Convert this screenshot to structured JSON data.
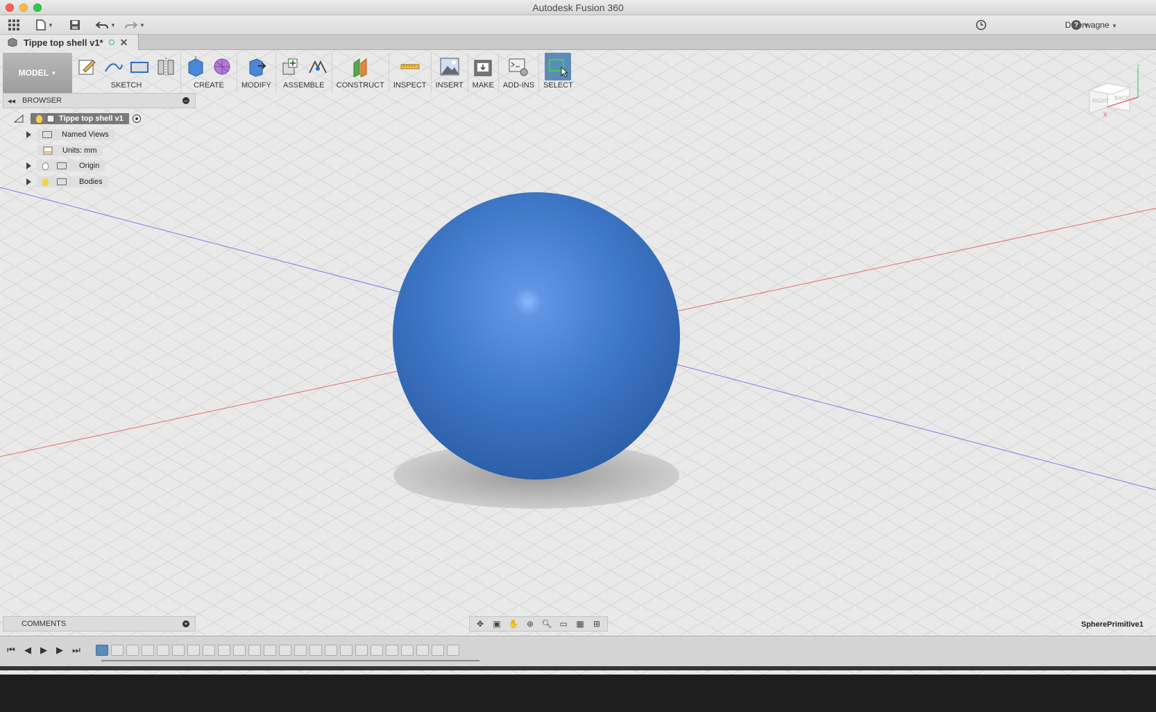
{
  "window": {
    "title": "Autodesk Fusion 360"
  },
  "qat": {
    "user": "D Terwagne",
    "help": "?"
  },
  "doc_tab": {
    "label": "Tippe top shell v1*"
  },
  "toolbar": {
    "workspace": "MODEL",
    "groups": [
      {
        "label": "SKETCH",
        "icons": [
          "create-sketch-icon",
          "spline-icon",
          "rectangle-icon",
          "mirror-icon"
        ]
      },
      {
        "label": "CREATE",
        "icons": [
          "extrude-box-icon",
          "form-icon"
        ]
      },
      {
        "label": "MODIFY",
        "icons": [
          "press-pull-icon"
        ]
      },
      {
        "label": "ASSEMBLE",
        "icons": [
          "new-component-icon",
          "joint-icon"
        ]
      },
      {
        "label": "CONSTRUCT",
        "icons": [
          "offset-plane-icon"
        ]
      },
      {
        "label": "INSPECT",
        "icons": [
          "measure-icon"
        ]
      },
      {
        "label": "INSERT",
        "icons": [
          "insert-image-icon"
        ]
      },
      {
        "label": "MAKE",
        "icons": [
          "3d-print-icon"
        ]
      },
      {
        "label": "ADD-INS",
        "icons": [
          "scripts-icon"
        ]
      },
      {
        "label": "SELECT",
        "icons": [
          "select-box-icon"
        ]
      }
    ]
  },
  "browser": {
    "title": "BROWSER",
    "root": "Tippe top shell v1",
    "items": [
      {
        "label": "Named Views"
      },
      {
        "label": "Units: mm"
      },
      {
        "label": "Origin"
      },
      {
        "label": "Bodies"
      }
    ]
  },
  "comments": {
    "title": "COMMENTS"
  },
  "viewcube": {
    "faces": [
      "RIGHT",
      "BACK"
    ],
    "axes": [
      "X",
      "Y"
    ]
  },
  "status": {
    "selection": "SpherePrimitive1"
  },
  "colors": {
    "accent": "#5d8bb9",
    "body": "#3a72c2",
    "x_axis": "#e05a5a",
    "z_axis": "#6a6ae0"
  },
  "timeline": {
    "feature_count": 24
  }
}
